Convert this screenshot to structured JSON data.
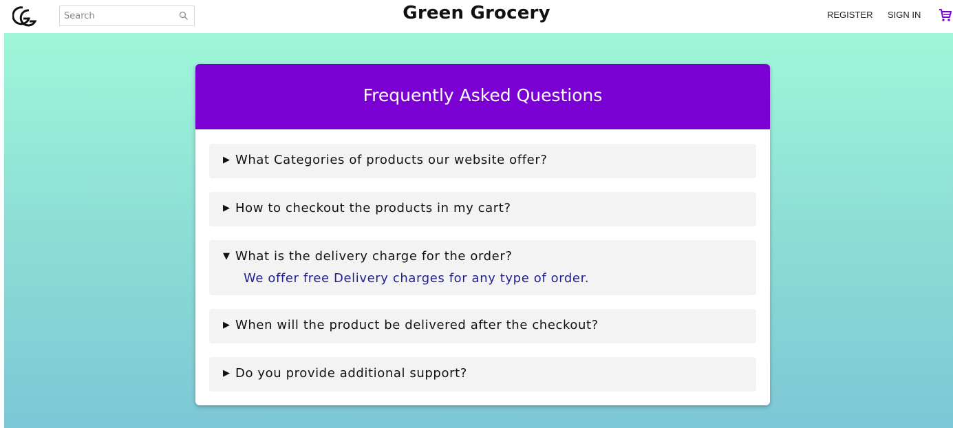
{
  "header": {
    "logo_text": "GG",
    "search": {
      "placeholder": "Search",
      "value": ""
    },
    "site_title": "Green Grocery",
    "nav": {
      "register": "REGISTER",
      "sign_in": "SIGN IN"
    },
    "icons": {
      "search": "search-icon",
      "cart": "cart-icon",
      "logo": "logo-icon"
    }
  },
  "faq": {
    "title": "Frequently Asked Questions",
    "items": [
      {
        "marker": "▶",
        "question": "What Categories of products our website offer?",
        "expanded": false
      },
      {
        "marker": "▶",
        "question": "How to checkout the products in my cart?",
        "expanded": false
      },
      {
        "marker": "▼",
        "question": "What is the delivery charge for the order?",
        "answer": "We offer free Delivery charges for any type of order.",
        "expanded": true
      },
      {
        "marker": "▶",
        "question": "When will the product be delivered after the checkout?",
        "expanded": false
      },
      {
        "marker": "▶",
        "question": "Do you provide additional support?",
        "expanded": false
      }
    ]
  },
  "colors": {
    "accent": "#7b00d4",
    "answer_text": "#1f1f8f",
    "bg_top": "#9ef7d8",
    "bg_bottom": "#7cc7d6"
  }
}
